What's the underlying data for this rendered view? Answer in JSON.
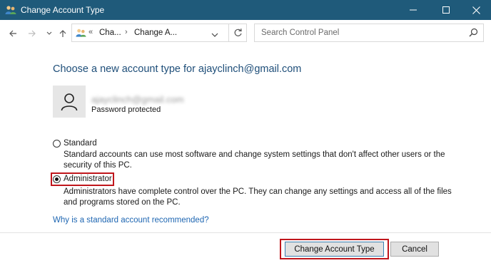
{
  "window": {
    "title": "Change Account Type"
  },
  "nav": {
    "breadcrumb_prefix": "«",
    "breadcrumb_1": "Cha...",
    "breadcrumb_sep": "›",
    "breadcrumb_2": "Change A...",
    "search_placeholder": "Search Control Panel"
  },
  "main": {
    "heading": "Choose a new account type for ajayclinch@gmail.com",
    "account": {
      "name": "ajayclinch@gmail.com",
      "status": "Password protected"
    },
    "options": [
      {
        "label": "Standard",
        "description": "Standard accounts can use most software and change system settings that don't affect other users or the security of this PC.",
        "selected": false
      },
      {
        "label": "Administrator",
        "description": "Administrators have complete control over the PC. They can change any settings and access all of the files and programs stored on the PC.",
        "selected": true
      }
    ],
    "help_link": "Why is a standard account recommended?"
  },
  "footer": {
    "primary_button": "Change Account Type",
    "cancel_button": "Cancel"
  },
  "colors": {
    "titlebar": "#1f5a7a",
    "heading": "#1e4e79",
    "link": "#1e66b2",
    "highlight": "#c0161c"
  },
  "icons": [
    "users-icon",
    "back-arrow-icon",
    "forward-arrow-icon",
    "recent-dropdown-icon",
    "up-arrow-icon",
    "refresh-icon",
    "search-icon",
    "user-avatar-icon",
    "minimize-icon",
    "maximize-icon",
    "close-icon"
  ]
}
